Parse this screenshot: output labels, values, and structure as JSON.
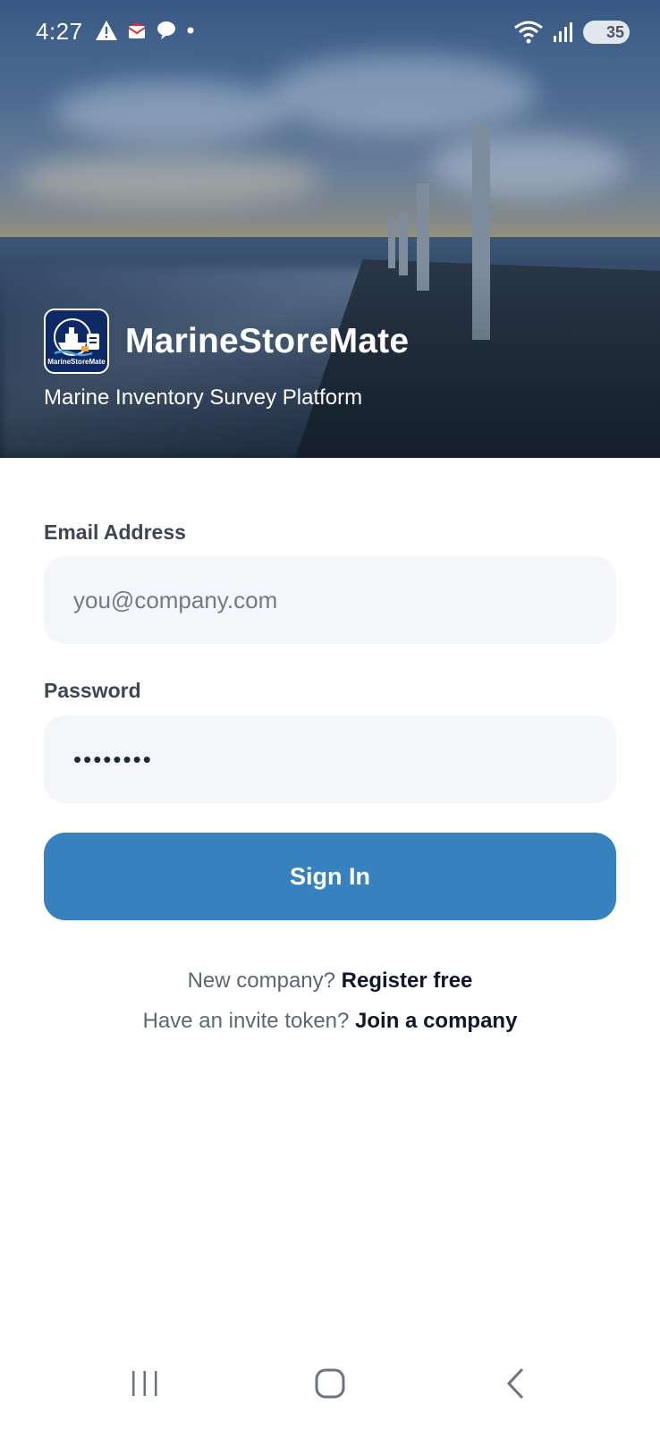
{
  "status_bar": {
    "time": "4:27",
    "battery": "35",
    "left_icons": [
      "warning-icon",
      "mail-notification-icon",
      "chat-bubble-icon",
      "dot-icon"
    ],
    "right_icons": [
      "wifi-icon",
      "signal-icon",
      "battery-icon"
    ]
  },
  "hero": {
    "app_name": "MarineStoreMate",
    "logo_text": "MarineStoreMate",
    "tagline": "Marine Inventory Survey Platform"
  },
  "form": {
    "email_label": "Email Address",
    "email_placeholder": "you@company.com",
    "email_value": "",
    "password_label": "Password",
    "password_value": "••••••••",
    "signin_label": "Sign In"
  },
  "links": {
    "register_prompt": "New company?",
    "register_action": "Register free",
    "join_prompt": "Have an invite token?",
    "join_action": "Join a company"
  },
  "nav": {
    "icons": [
      "recent-apps-icon",
      "home-icon",
      "back-icon"
    ]
  },
  "colors": {
    "primary": "#3881bf",
    "input_bg": "#f4f6f9",
    "label": "#3f4653",
    "link": "#0f172a"
  }
}
